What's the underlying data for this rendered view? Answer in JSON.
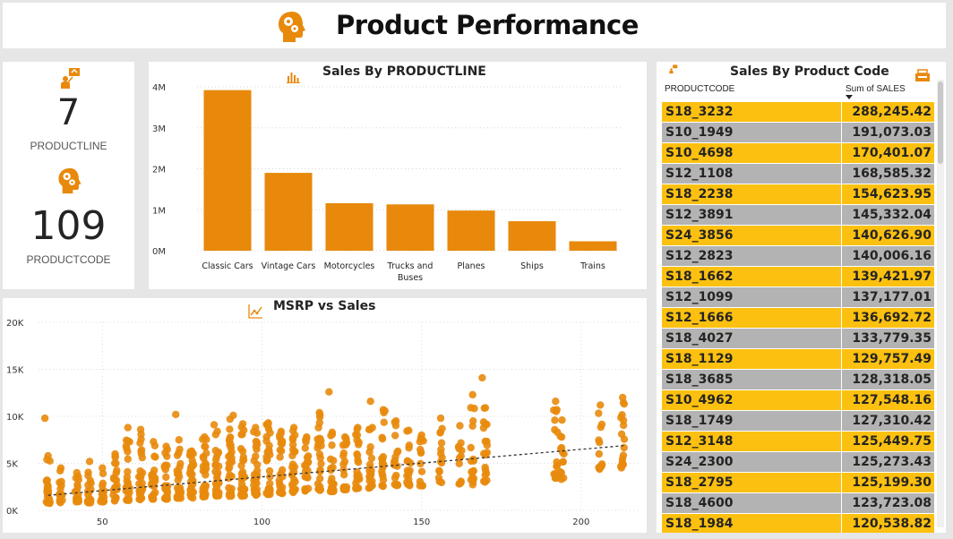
{
  "header": {
    "title": "Product Performance",
    "logo_icon": "head-gears-icon"
  },
  "kpis": [
    {
      "value": "7",
      "label": "PRODUCTLINE",
      "icon": "presenter-icon"
    },
    {
      "value": "109",
      "label": "PRODUCTCODE",
      "icon": "head-gears-icon"
    }
  ],
  "colors": {
    "accent": "#e8890c",
    "gold": "#fcc010",
    "gray": "#b3b3b3"
  },
  "chart_data": [
    {
      "type": "bar",
      "title": "Sales By PRODUCTLINE",
      "categories": [
        "Classic Cars",
        "Vintage Cars",
        "Motorcycles",
        "Trucks and Buses",
        "Planes",
        "Ships",
        "Trains"
      ],
      "category_lines": [
        [
          "Classic Cars"
        ],
        [
          "Vintage Cars"
        ],
        [
          "Motorcycles"
        ],
        [
          "Trucks and",
          "Buses"
        ],
        [
          "Planes"
        ],
        [
          "Ships"
        ],
        [
          "Trains"
        ]
      ],
      "values": [
        3920000,
        1900000,
        1160000,
        1130000,
        980000,
        720000,
        230000
      ],
      "yticks": [
        0,
        1000000,
        2000000,
        3000000,
        4000000
      ],
      "ytick_labels": [
        "0M",
        "1M",
        "2M",
        "3M",
        "4M"
      ],
      "ylim": [
        0,
        4000000
      ],
      "grid": true
    },
    {
      "type": "scatter",
      "title": "MSRP vs Sales",
      "xticks": [
        50,
        100,
        150,
        200
      ],
      "yticks": [
        0,
        5000,
        10000,
        15000,
        20000
      ],
      "ytick_labels": [
        "0K",
        "5K",
        "10K",
        "15K",
        "20K"
      ],
      "xlim": [
        30,
        218
      ],
      "ylim": [
        0,
        20000
      ],
      "trendline": {
        "from": [
          33,
          1600
        ],
        "to": [
          214,
          6900
        ]
      },
      "grid": true,
      "point_groups": [
        {
          "x": 33,
          "y_min": 700,
          "y_max": 5800,
          "n": 22
        },
        {
          "x": 37,
          "y_min": 800,
          "y_max": 4500,
          "n": 14
        },
        {
          "x": 42,
          "y_min": 900,
          "y_max": 4000,
          "n": 16
        },
        {
          "x": 46,
          "y_min": 800,
          "y_max": 5200,
          "n": 18
        },
        {
          "x": 50,
          "y_min": 900,
          "y_max": 4500,
          "n": 14
        },
        {
          "x": 54,
          "y_min": 1000,
          "y_max": 6000,
          "n": 22
        },
        {
          "x": 58,
          "y_min": 1000,
          "y_max": 8800,
          "n": 24
        },
        {
          "x": 62,
          "y_min": 1100,
          "y_max": 8600,
          "n": 26
        },
        {
          "x": 66,
          "y_min": 1200,
          "y_max": 7300,
          "n": 28
        },
        {
          "x": 70,
          "y_min": 1200,
          "y_max": 6800,
          "n": 28
        },
        {
          "x": 74,
          "y_min": 1300,
          "y_max": 7500,
          "n": 28
        },
        {
          "x": 78,
          "y_min": 1300,
          "y_max": 6300,
          "n": 28
        },
        {
          "x": 82,
          "y_min": 1400,
          "y_max": 7800,
          "n": 30
        },
        {
          "x": 86,
          "y_min": 1400,
          "y_max": 8400,
          "n": 28
        },
        {
          "x": 90,
          "y_min": 1500,
          "y_max": 9700,
          "n": 28
        },
        {
          "x": 94,
          "y_min": 1500,
          "y_max": 9200,
          "n": 28
        },
        {
          "x": 98,
          "y_min": 1600,
          "y_max": 8800,
          "n": 30
        },
        {
          "x": 102,
          "y_min": 1700,
          "y_max": 9300,
          "n": 30
        },
        {
          "x": 106,
          "y_min": 1800,
          "y_max": 8400,
          "n": 26
        },
        {
          "x": 110,
          "y_min": 1900,
          "y_max": 8800,
          "n": 26
        },
        {
          "x": 114,
          "y_min": 2000,
          "y_max": 7800,
          "n": 24
        },
        {
          "x": 118,
          "y_min": 2100,
          "y_max": 10400,
          "n": 24
        },
        {
          "x": 122,
          "y_min": 2000,
          "y_max": 8300,
          "n": 24
        },
        {
          "x": 126,
          "y_min": 2200,
          "y_max": 7800,
          "n": 20
        },
        {
          "x": 130,
          "y_min": 2300,
          "y_max": 8800,
          "n": 22
        },
        {
          "x": 134,
          "y_min": 2300,
          "y_max": 11600,
          "n": 22
        },
        {
          "x": 138,
          "y_min": 2400,
          "y_max": 10700,
          "n": 20
        },
        {
          "x": 142,
          "y_min": 2500,
          "y_max": 9500,
          "n": 18
        },
        {
          "x": 146,
          "y_min": 2600,
          "y_max": 8500,
          "n": 18
        },
        {
          "x": 150,
          "y_min": 2600,
          "y_max": 8000,
          "n": 14
        },
        {
          "x": 156,
          "y_min": 2800,
          "y_max": 9800,
          "n": 14
        },
        {
          "x": 162,
          "y_min": 2800,
          "y_max": 9000,
          "n": 12
        },
        {
          "x": 166,
          "y_min": 2700,
          "y_max": 12300,
          "n": 16
        },
        {
          "x": 170,
          "y_min": 3000,
          "y_max": 10900,
          "n": 18
        },
        {
          "x": 192,
          "y_min": 3300,
          "y_max": 11600,
          "n": 16
        },
        {
          "x": 194,
          "y_min": 3300,
          "y_max": 9600,
          "n": 12
        },
        {
          "x": 206,
          "y_min": 4300,
          "y_max": 11200,
          "n": 12
        },
        {
          "x": 213,
          "y_min": 4500,
          "y_max": 12000,
          "n": 16
        }
      ],
      "extra_points": [
        [
          32,
          9800
        ],
        [
          85,
          9100
        ],
        [
          121,
          12600
        ],
        [
          169,
          14100
        ],
        [
          91,
          10100
        ],
        [
          73,
          10200
        ]
      ]
    }
  ],
  "table": {
    "title": "Sales By Product Code",
    "col1": "PRODUCTCODE",
    "col2": "Sum of SALES",
    "rows": [
      [
        "S18_3232",
        "288,245.42"
      ],
      [
        "S10_1949",
        "191,073.03"
      ],
      [
        "S10_4698",
        "170,401.07"
      ],
      [
        "S12_1108",
        "168,585.32"
      ],
      [
        "S18_2238",
        "154,623.95"
      ],
      [
        "S12_3891",
        "145,332.04"
      ],
      [
        "S24_3856",
        "140,626.90"
      ],
      [
        "S12_2823",
        "140,006.16"
      ],
      [
        "S18_1662",
        "139,421.97"
      ],
      [
        "S12_1099",
        "137,177.01"
      ],
      [
        "S12_1666",
        "136,692.72"
      ],
      [
        "S18_4027",
        "133,779.35"
      ],
      [
        "S18_1129",
        "129,757.49"
      ],
      [
        "S18_3685",
        "128,318.05"
      ],
      [
        "S10_4962",
        "127,548.16"
      ],
      [
        "S18_1749",
        "127,310.42"
      ],
      [
        "S12_3148",
        "125,449.75"
      ],
      [
        "S24_2300",
        "125,273.43"
      ],
      [
        "S18_2795",
        "125,199.30"
      ],
      [
        "S18_4600",
        "123,723.08"
      ],
      [
        "S18_1984",
        "120,538.82"
      ]
    ]
  }
}
